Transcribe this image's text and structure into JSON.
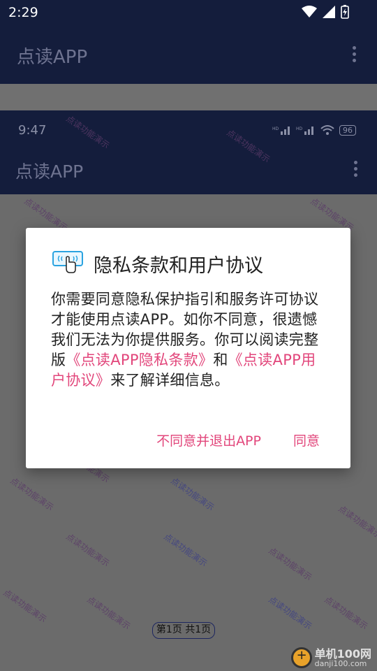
{
  "status_bar": {
    "time": "2:29"
  },
  "app_bar": {
    "title": "点读APP"
  },
  "inner_screenshot": {
    "status_time": "9:47",
    "battery": "96",
    "title": "点读APP",
    "page_indicator": "第1页 共1页"
  },
  "watermark_text": "点读功能演示",
  "dialog": {
    "title": "隐私条款和用户协议",
    "body_prefix": "你需要同意隐私保护指引和服务许可协议才能使用点读APP。如你不同意，很遗憾我们无法为你提供服务。你可以阅读完整版",
    "privacy_link": "《点读APP隐私条款》",
    "body_and": "和",
    "agreement_link": "《点读APP用户协议》",
    "body_suffix": "来了解详细信息。",
    "decline_label": "不同意并退出APP",
    "agree_label": "同意"
  },
  "site_logo": {
    "name": "单机100网",
    "url": "danji100.com"
  },
  "colors": {
    "accent": "#e2467b",
    "appbar": "#141d3c"
  }
}
